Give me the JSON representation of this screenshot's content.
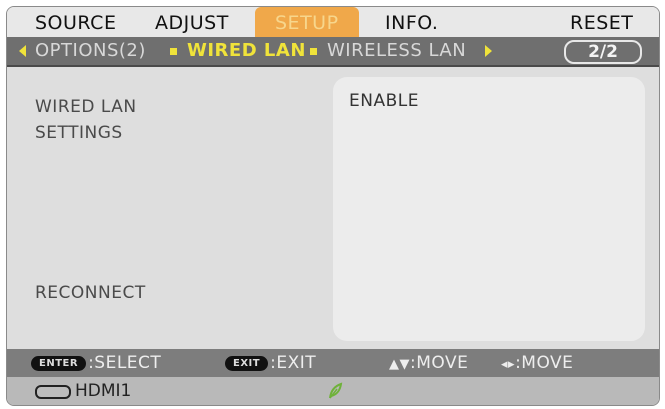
{
  "tabs": [
    {
      "label": "SOURCE"
    },
    {
      "label": "ADJUST"
    },
    {
      "label": "SETUP",
      "active": true
    },
    {
      "label": "INFO."
    },
    {
      "label": "RESET"
    }
  ],
  "subtabs": [
    {
      "label": "OPTIONS(2)"
    },
    {
      "label": "WIRED LAN",
      "active": true
    },
    {
      "label": "WIRELESS LAN"
    }
  ],
  "page_indicator": "2/2",
  "items": {
    "wired_lan": "WIRED LAN",
    "settings": "SETTINGS",
    "reconnect": "RECONNECT"
  },
  "values": {
    "wired_lan": "ENABLE"
  },
  "help": {
    "enter_key": "ENTER",
    "select": ":SELECT",
    "exit_key": "EXIT",
    "exit": ":EXIT",
    "move_ud": ":MOVE",
    "move_lr": ":MOVE"
  },
  "status": {
    "source": "HDMI1"
  },
  "colors": {
    "active_tab": "#f0a84a",
    "active_subtab": "#f0e33a",
    "eco": "#6fb23a"
  },
  "icons": [
    "hdmi-connector-icon",
    "eco-leaf-icon",
    "arrow-up-down-icon",
    "arrow-left-right-icon"
  ]
}
